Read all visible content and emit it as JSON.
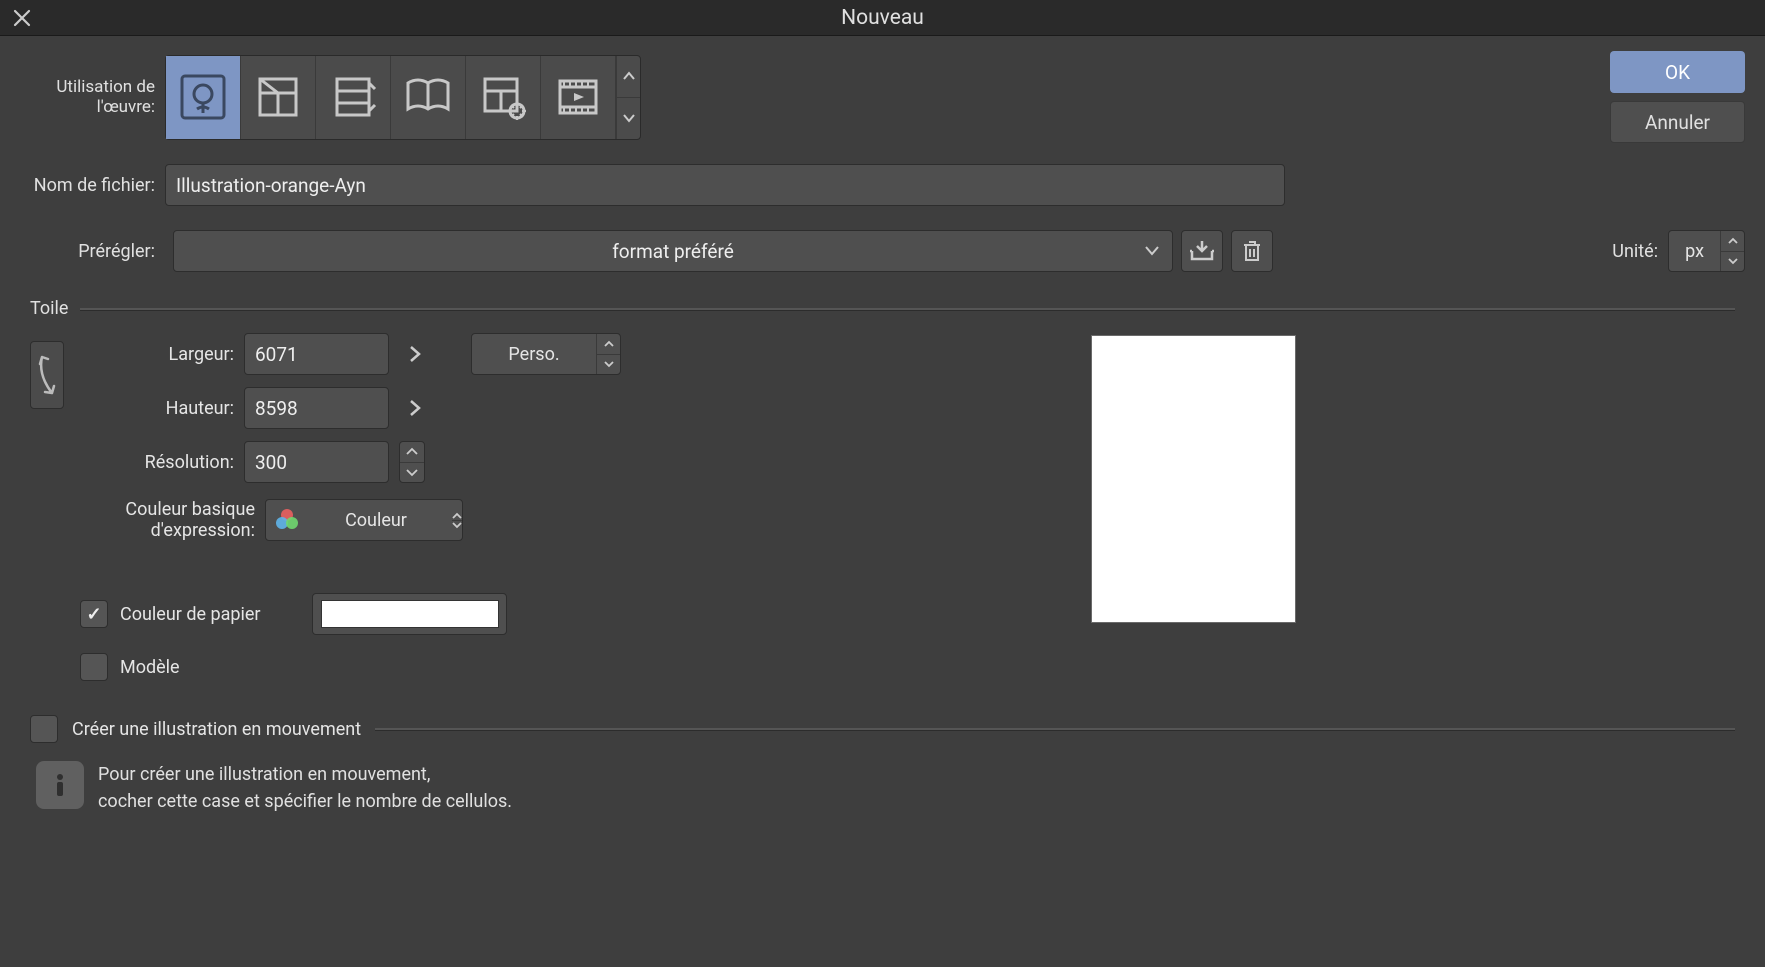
{
  "title": "Nouveau",
  "buttons": {
    "ok": "OK",
    "cancel": "Annuler"
  },
  "labels": {
    "usage": "Utilisation de l'œuvre:",
    "filename": "Nom de fichier:",
    "preset": "Prérégler:",
    "unit": "Unité:",
    "canvas_section": "Toile",
    "width": "Largeur:",
    "height": "Hauteur:",
    "resolution": "Résolution:",
    "basic_color": "Couleur basique d'expression:",
    "paper_color": "Couleur de papier",
    "template": "Modèle",
    "create_anim": "Créer une illustration en mouvement"
  },
  "values": {
    "filename": "Illustration-orange-Ayn",
    "preset": "format préféré",
    "unit": "px",
    "width": "6071",
    "height": "8598",
    "resolution": "300",
    "size_preset": "Perso.",
    "color_mode": "Couleur",
    "paper_color_checked": true,
    "template_checked": false,
    "create_anim_checked": false,
    "paper_swatch": "#ffffff"
  },
  "info": {
    "line1": "Pour créer une illustration en mouvement,",
    "line2": "cocher cette case et spécifier le nombre de cellulos."
  }
}
